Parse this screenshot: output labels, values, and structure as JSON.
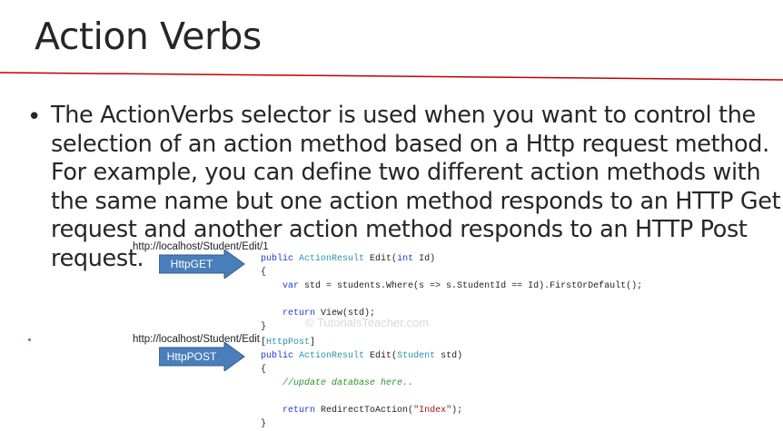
{
  "slide": {
    "title": "Action Verbs",
    "bullet": "The ActionVerbs selector is used when you want to control the selection of an action method based on a Http request method. For example, you can define two different action methods with the same name but one action method responds to an HTTP Get request and another action method responds to an HTTP Post request.",
    "accent_color": "#c00000"
  },
  "diagram": {
    "get": {
      "url": "http://localhost/Student/Edit/1",
      "arrow_label": "HttpGET",
      "code": [
        "public ActionResult Edit(int Id)",
        "{",
        "    var std = students.Where(s => s.StudentId == Id).FirstOrDefault();",
        "",
        "    return View(std);",
        "}"
      ]
    },
    "post": {
      "url": "http://localhost/Student/Edit",
      "arrow_label": "HttpPOST",
      "code": [
        "[HttpPost]",
        "public ActionResult Edit(Student std)",
        "{",
        "    //update database here..",
        "",
        "    return RedirectToAction(\"Index\");",
        "}"
      ]
    },
    "watermark": "© TutorialsTeacher.com",
    "arrow_color": "#4a7ebb"
  }
}
